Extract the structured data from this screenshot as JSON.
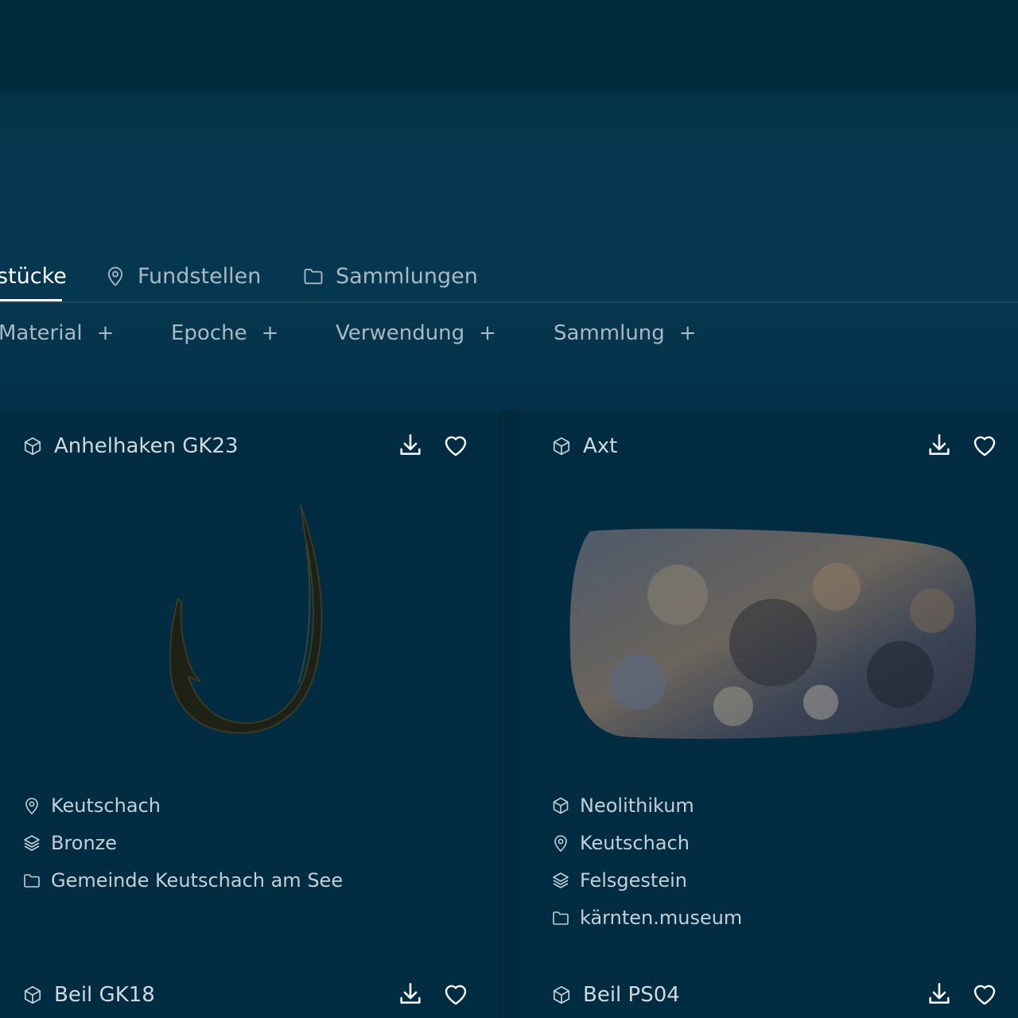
{
  "tabs": [
    {
      "label": "stücke",
      "icon": "none",
      "active": true
    },
    {
      "label": "Fundstellen",
      "icon": "map-pin-icon",
      "active": false
    },
    {
      "label": "Sammlungen",
      "icon": "folder-icon",
      "active": false
    }
  ],
  "filters": [
    {
      "label": "Material",
      "plus": "+"
    },
    {
      "label": "Epoche",
      "plus": "+"
    },
    {
      "label": "Verwendung",
      "plus": "+"
    },
    {
      "label": "Sammlung",
      "plus": "+"
    }
  ],
  "cards": [
    {
      "title": "Anhelhaken GK23",
      "image": "fish-hook",
      "meta": [
        {
          "icon": "map-pin-icon",
          "text": "Keutschach"
        },
        {
          "icon": "layers-icon",
          "text": "Bronze"
        },
        {
          "icon": "folder-icon",
          "text": "Gemeinde Keutschach am See"
        }
      ]
    },
    {
      "title": "Axt",
      "image": "stone-axe",
      "meta": [
        {
          "icon": "cube-icon",
          "text": "Neolithikum"
        },
        {
          "icon": "map-pin-icon",
          "text": "Keutschach"
        },
        {
          "icon": "layers-icon",
          "text": "Felsgestein"
        },
        {
          "icon": "folder-icon",
          "text": "kärnten.museum"
        }
      ]
    },
    {
      "title": "Beil GK18"
    },
    {
      "title": "Beil PS04"
    }
  ],
  "colors": {
    "background": "#012a3f",
    "hero": "#053850",
    "text": "#c9d6dd",
    "active_tab": "#ffffff"
  }
}
